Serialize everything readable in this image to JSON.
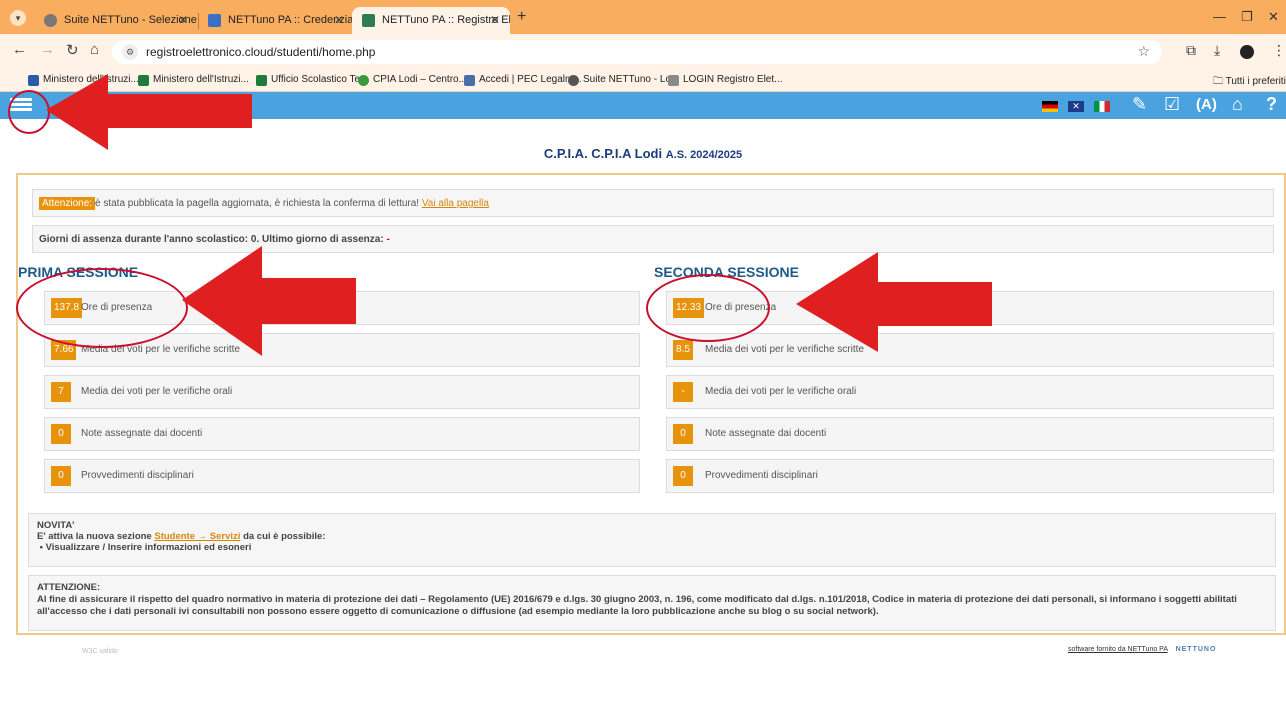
{
  "browser": {
    "tabs": [
      {
        "title": "Suite NETTuno - Selezione del",
        "active": false
      },
      {
        "title": "NETTuno PA :: Credenziali Stud",
        "active": false
      },
      {
        "title": "NETTuno PA :: Registro Elettron",
        "active": true
      }
    ],
    "url": "registroelettronico.cloud/studenti/home.php",
    "bookmarks": [
      "Ministero dell'Istruzi...",
      "Ministero dell'Istruzi...",
      "Ufficio Scolastico Te...",
      "CPIA Lodi – Centro...",
      "Accedi | PEC Legalm...",
      "Suite NETTuno - Lo...",
      "LOGIN Registro Elet..."
    ],
    "all_bookmarks": "Tutti i preferiti"
  },
  "header": {
    "school": "C.P.I.A. C.P.I.A Lodi",
    "year": "A.S. 2024/2025"
  },
  "alert": {
    "badge": "Attenzione:",
    "text": "è stata pubblicata la pagella aggiornata, è richiesta la conferma di lettura!",
    "link": "Vai alla pagella"
  },
  "absence": {
    "label": "Giorni di assenza durante l'anno scolastico:",
    "days": "0",
    "last_label": "Ultimo giorno di assenza:",
    "last": "-"
  },
  "sessions": [
    {
      "title": "PRIMA SESSIONE",
      "stats": [
        {
          "value": "137.8",
          "label": "Ore di presenza"
        },
        {
          "value": "7.66",
          "label": "Media dei voti per le verifiche scritte"
        },
        {
          "value": "7",
          "label": "Media dei voti per le verifiche orali"
        },
        {
          "value": "0",
          "label": "Note assegnate dai docenti"
        },
        {
          "value": "0",
          "label": "Provvedimenti disciplinari"
        }
      ]
    },
    {
      "title": "SECONDA SESSIONE",
      "stats": [
        {
          "value": "12.33",
          "label": "Ore di presenza"
        },
        {
          "value": "8.5",
          "label": "Media dei voti per le verifiche scritte"
        },
        {
          "value": "-",
          "label": "Media dei voti per le verifiche orali"
        },
        {
          "value": "0",
          "label": "Note assegnate dai docenti"
        },
        {
          "value": "0",
          "label": "Provvedimenti disciplinari"
        }
      ]
    }
  ],
  "novita": {
    "title": "NOVITA'",
    "line_prefix": "E' attiva la nuova sezione",
    "link": "Studente → Servizi",
    "line_suffix": "da cui è possibile:",
    "item": "Visualizzare / Inserire informazioni ed esoneri"
  },
  "notice": {
    "title": "ATTENZIONE:",
    "text": "Al fine di assicurare il rispetto del quadro normativo in materia di protezione dei dati – Regolamento (UE) 2016/679 e d.lgs. 30 giugno 2003, n. 196, come modificato dal d.lgs. n.101/2018, Codice in materia di protezione dei dati personali, si informano i soggetti abilitati all'accesso che i dati personali ivi consultabili non possono essere oggetto di comunicazione o diffusione (ad esempio mediante la loro pubblicazione anche su blog o su social network)."
  },
  "footer": {
    "left": "W3C valido",
    "right": "software fornito da NETTuno PA",
    "logo": "NETTUNO"
  },
  "colors": {
    "app_bar": "#4aa3df",
    "badge": "#e8930c",
    "annotation": "#c8102e"
  }
}
